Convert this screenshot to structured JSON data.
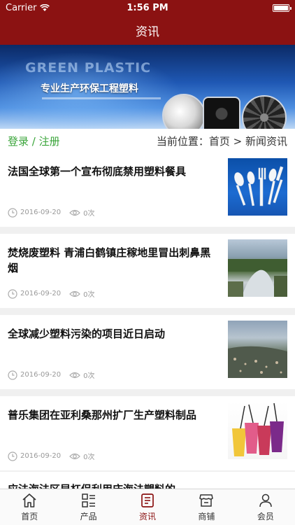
{
  "status": {
    "carrier": "Carrier",
    "time": "1:56 PM",
    "battery_level": 1.0
  },
  "nav": {
    "title": "资讯"
  },
  "banner": {
    "english": "GREEN PLASTIC",
    "chinese": "专业生产环保工程塑料"
  },
  "breadcrumb": {
    "login": "登录",
    "separator": "/",
    "register": "注册",
    "location": "当前位置：首页 > 新闻资讯"
  },
  "news": [
    {
      "title": "法国全球第一个宣布彻底禁用塑料餐具",
      "date": "2016-09-20",
      "views": "0次"
    },
    {
      "title": "焚烧废塑料 青浦白鹤镇庄稼地里冒出刺鼻黑烟",
      "date": "2016-09-20",
      "views": "0次"
    },
    {
      "title": "全球减少塑料污染的项目近日启动",
      "date": "2016-09-20",
      "views": "0次"
    },
    {
      "title": "普乐集团在亚利桑那州扩厂生产塑料制品",
      "date": "2016-09-20",
      "views": "0次"
    },
    {
      "title": "应法海法区早杠侣利用床海法塑料的"
    }
  ],
  "tabs": [
    {
      "label": "首页",
      "icon": "home-icon"
    },
    {
      "label": "产品",
      "icon": "grid-list-icon"
    },
    {
      "label": "资讯",
      "icon": "news-icon"
    },
    {
      "label": "商铺",
      "icon": "shop-icon"
    },
    {
      "label": "会员",
      "icon": "user-icon"
    }
  ],
  "colors": {
    "brand": "#8b1212",
    "login": "#3aa53a"
  }
}
